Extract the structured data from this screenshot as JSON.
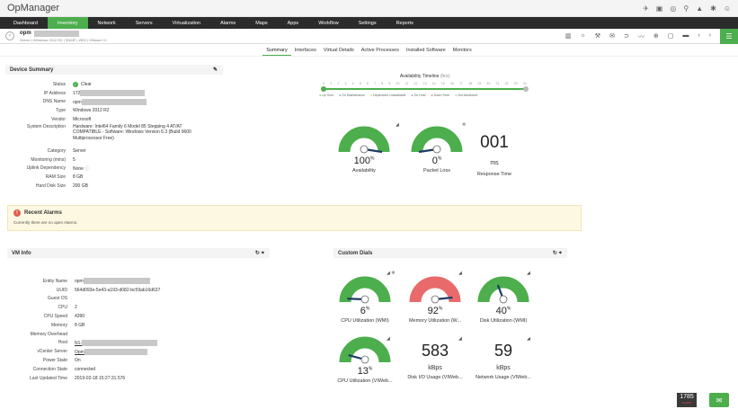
{
  "app": {
    "title": "OpManager"
  },
  "nav": [
    "Dashboard",
    "Inventory",
    "Network",
    "Servers",
    "Virtualization",
    "Alarms",
    "Maps",
    "Apps",
    "Workflow",
    "Settings",
    "Reports"
  ],
  "device": {
    "name": "opm",
    "subtitle": "Server | Windows 2012 R2 | SNMP | WMI | VMware VI"
  },
  "tabs": [
    "Summary",
    "Interfaces",
    "Virtual Details",
    "Active Processes",
    "Installed Software",
    "Monitors"
  ],
  "summary": {
    "title": "Device Summary",
    "rows": [
      {
        "label": "Status",
        "value": "Clear"
      },
      {
        "label": "IP Address",
        "value": "172"
      },
      {
        "label": "DNS Name",
        "value": "opm"
      },
      {
        "label": "Type",
        "value": "Windows 2012 R2"
      },
      {
        "label": "Vendor",
        "value": "Microsoft"
      },
      {
        "label": "System Description",
        "value": "Hardware: Intel64 Family 6 Model 85 Stepping 4 AT/AT COMPATIBLE - Software: Windows Version 6.3 (Build 9600 Multiprocessor Free)"
      },
      {
        "label": "Category",
        "value": "Server"
      },
      {
        "label": "Monitoring (mins)",
        "value": "5"
      },
      {
        "label": "Uplink Dependency",
        "value": "None"
      },
      {
        "label": "RAM Size",
        "value": "8 GB"
      },
      {
        "label": "Hard Disk Size",
        "value": "200 GB"
      }
    ]
  },
  "availability": {
    "title": "Availability Timeline",
    "subtitle": "(hrs)",
    "hours": [
      "0",
      "1",
      "2",
      "3",
      "4",
      "5",
      "6",
      "7",
      "8",
      "9",
      "10",
      "11",
      "12",
      "13",
      "14",
      "15",
      "16",
      "17",
      "18",
      "19",
      "20",
      "21",
      "22",
      "23",
      "24"
    ],
    "legend": [
      "Up Time",
      "On Maintenance",
      "Dependent Unavailable",
      "On Hold",
      "Down Time",
      "Not Monitored"
    ],
    "legend_colors": [
      "#4cae4c",
      "#2f7fc0",
      "#f0c419",
      "#9b59b6",
      "#e74c3c",
      "#aaaaaa"
    ]
  },
  "top_gauges": [
    {
      "value": "100",
      "unit": "%",
      "label": "Availability",
      "percent": 100,
      "color": "#4cae4c"
    },
    {
      "value": "0",
      "unit": "%",
      "label": "Packet Loss",
      "percent": 0,
      "color": "#4cae4c"
    }
  ],
  "response": {
    "value": "001",
    "unit": "ms",
    "label": "Response Time"
  },
  "alarms": {
    "title": "Recent Alarms",
    "text": "Currently there are no open Alarms."
  },
  "vm": {
    "title": "VM Info",
    "rows": [
      {
        "label": "Entity Name",
        "value": "opm"
      },
      {
        "label": "UUID",
        "value": "564d093e-5e43-a193-d082-bc59ab16d637"
      },
      {
        "label": "Guest OS",
        "value": ""
      },
      {
        "label": "CPU",
        "value": "2"
      },
      {
        "label": "CPU Speed",
        "value": "4390"
      },
      {
        "label": "Memory",
        "value": "8 GB"
      },
      {
        "label": "Memory Overhead",
        "value": ""
      },
      {
        "label": "Host",
        "value": "N1-"
      },
      {
        "label": "vCenter Server",
        "value": "Opm"
      },
      {
        "label": "Power State",
        "value": "On"
      },
      {
        "label": "Connection State",
        "value": "connected"
      },
      {
        "label": "Last Updated Time",
        "value": "2019-02-18 15:27:31.576"
      }
    ]
  },
  "custom": {
    "title": "Custom Dials",
    "gauges": [
      {
        "value": "6",
        "unit": "%",
        "label": "CPU Utilization (WMI)",
        "percent": 6,
        "color": "#4cae4c"
      },
      {
        "value": "92",
        "unit": "%",
        "label": "Memory Utilization (W...",
        "percent": 92,
        "color": "#e86a6a"
      },
      {
        "value": "40",
        "unit": "%",
        "label": "Disk Utilization (WMI)",
        "percent": 40,
        "color": "#4cae4c"
      },
      {
        "value": "13",
        "unit": "%",
        "label": "CPU Utilization (VIWeb...",
        "percent": 13,
        "color": "#4cae4c"
      }
    ],
    "numbers": [
      {
        "value": "583",
        "unit": "kBps",
        "label": "Disk I/O Usage (VIWeb..."
      },
      {
        "value": "59",
        "unit": "kBps",
        "label": "Network Usage (VIWeb..."
      }
    ]
  },
  "counter": {
    "value": "1785",
    "sub": "ALARMS"
  }
}
